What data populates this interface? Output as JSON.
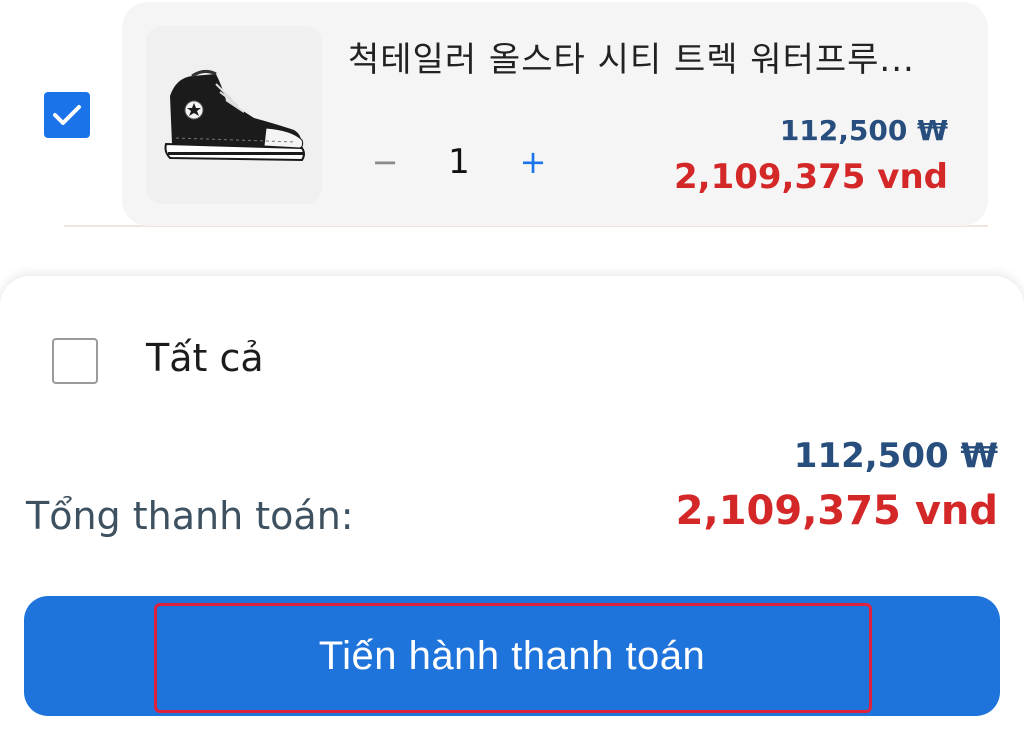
{
  "cart_item": {
    "selected": true,
    "product_name": "척테일러 올스타 시티 트렉 워터프루...",
    "quantity": "1",
    "qty_decrease_symbol": "−",
    "qty_increase_symbol": "+",
    "price_krw": "112,500 ₩",
    "price_vnd": "2,109,375 vnd",
    "image_icon": "high-top-sneaker"
  },
  "summary": {
    "select_all_label": "Tất cả",
    "select_all_checked": false,
    "total_krw": "112,500 ₩",
    "total_label": "Tổng thanh toán:",
    "total_vnd": "2,109,375 vnd",
    "checkout_label": "Tiến hành thanh toán"
  },
  "colors": {
    "accent_blue": "#1f74dc",
    "price_red": "#d42727",
    "krw_navy": "#284e7e",
    "highlight_red": "#e0213e"
  }
}
